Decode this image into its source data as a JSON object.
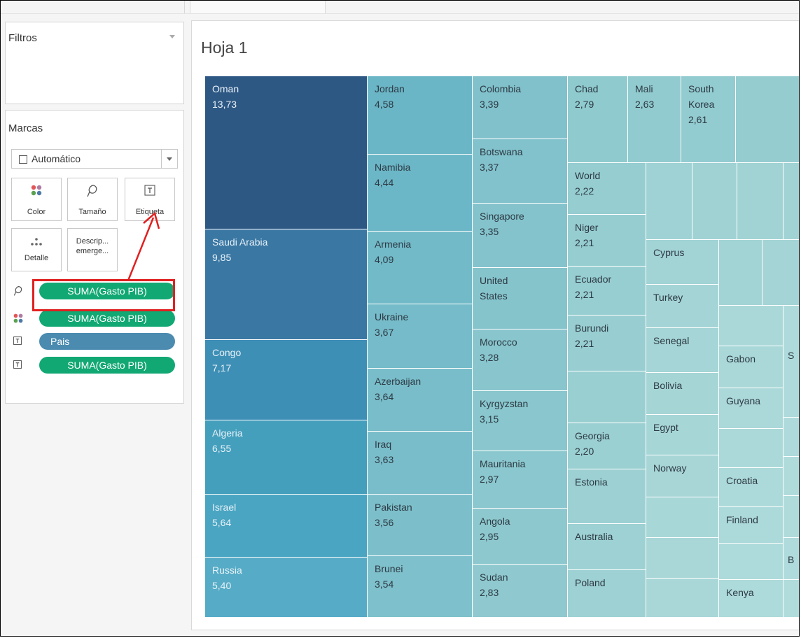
{
  "left_panel": {
    "filters_title": "Filtros",
    "marks_title": "Marcas",
    "mark_type": "Automático",
    "buttons": {
      "color": "Color",
      "size": "Tamaño",
      "label": "Etiqueta",
      "detail": "Detalle",
      "tooltip_line1": "Descrip...",
      "tooltip_line2": "emerge..."
    },
    "pills": [
      {
        "field": "SUMA(Gasto PIB)",
        "encoding": "size"
      },
      {
        "field": "SUMA(Gasto PIB)",
        "encoding": "color"
      },
      {
        "field": "Pais",
        "encoding": "label"
      },
      {
        "field": "SUMA(Gasto PIB)",
        "encoding": "label"
      }
    ]
  },
  "sheet": {
    "title": "Hoja 1"
  },
  "colors": {
    "pill_green": "#12a874",
    "pill_blue": "#4b8bb0",
    "highlight_red": "#e02020",
    "treemap_dark": "#2e5884",
    "treemap_light": "#a4d6d6"
  },
  "chart_data": {
    "type": "treemap",
    "measure": "SUMA(Gasto PIB)",
    "dimension": "Pais",
    "items": [
      {
        "name": "Oman",
        "value": "13,73"
      },
      {
        "name": "Saudi Arabia",
        "value": "9,85"
      },
      {
        "name": "Congo",
        "value": "7,17"
      },
      {
        "name": "Algeria",
        "value": "6,55"
      },
      {
        "name": "Israel",
        "value": "5,64"
      },
      {
        "name": "Russia",
        "value": "5,40"
      },
      {
        "name": "Jordan",
        "value": "4,58"
      },
      {
        "name": "Namibia",
        "value": "4,44"
      },
      {
        "name": "Armenia",
        "value": "4,09"
      },
      {
        "name": "Ukraine",
        "value": "3,67"
      },
      {
        "name": "Azerbaijan",
        "value": "3,64"
      },
      {
        "name": "Iraq",
        "value": "3,63"
      },
      {
        "name": "Pakistan",
        "value": "3,56"
      },
      {
        "name": "Brunei",
        "value": "3,54"
      },
      {
        "name": "Colombia",
        "value": "3,39"
      },
      {
        "name": "Botswana",
        "value": "3,37"
      },
      {
        "name": "Singapore",
        "value": "3,35"
      },
      {
        "name": "United\nStates",
        "value": ""
      },
      {
        "name": "Morocco",
        "value": "3,28"
      },
      {
        "name": "Kyrgyzstan",
        "value": "3,15"
      },
      {
        "name": "Mauritania",
        "value": "2,97"
      },
      {
        "name": "Angola",
        "value": "2,95"
      },
      {
        "name": "Sudan",
        "value": "2,83"
      },
      {
        "name": "Chad",
        "value": "2,79"
      },
      {
        "name": "Mali",
        "value": "2,63"
      },
      {
        "name": "South\nKorea",
        "value": "2,61"
      },
      {
        "name": "World",
        "value": "2,22"
      },
      {
        "name": "Niger",
        "value": "2,21"
      },
      {
        "name": "Ecuador",
        "value": "2,21"
      },
      {
        "name": "Burundi",
        "value": "2,21"
      },
      {
        "name": "Georgia",
        "value": "2,20"
      },
      {
        "name": "Estonia",
        "value": ""
      },
      {
        "name": "Australia",
        "value": ""
      },
      {
        "name": "Poland",
        "value": ""
      },
      {
        "name": "Cyprus",
        "value": ""
      },
      {
        "name": "Turkey",
        "value": ""
      },
      {
        "name": "Senegal",
        "value": ""
      },
      {
        "name": "Bolivia",
        "value": ""
      },
      {
        "name": "Egypt",
        "value": ""
      },
      {
        "name": "Norway",
        "value": ""
      },
      {
        "name": "Gabon",
        "value": ""
      },
      {
        "name": "Guyana",
        "value": ""
      },
      {
        "name": "Croatia",
        "value": ""
      },
      {
        "name": "Finland",
        "value": ""
      },
      {
        "name": "Kenya",
        "value": ""
      },
      {
        "name": "S",
        "value": ""
      },
      {
        "name": "B",
        "value": ""
      }
    ]
  }
}
